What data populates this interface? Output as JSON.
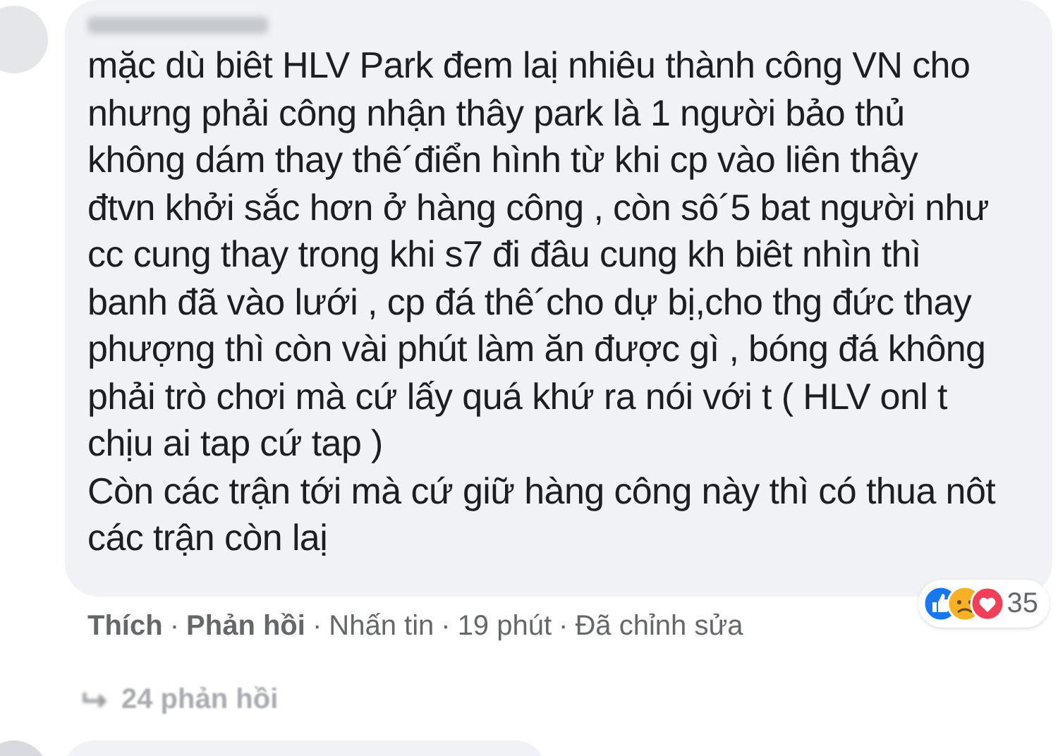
{
  "comment": {
    "lines": [
      "mặc dù biêt HLV Park đem laị nhiêu thành công VN cho",
      "nhưng phải công nhận thây park là 1 người bảo thủ",
      "không dám thay thê´điển hình từ khi cp vào liên thây",
      "đtvn khởi sắc hơn ở hàng công , còn sô´5 bat người như",
      "cc cung thay trong khi s7 đi đâu cung kh biêt nhìn thì",
      "banh đã vào lưới , cp đá thê´cho dự bị,cho thg đức thay",
      "phượng thì còn vài phút làm ăn được gì , bóng đá không",
      "phải trò chơi mà cứ lấy quá khứ ra nói với t ( HLV onl t",
      "chịu ai tap cứ tap )",
      "Còn các trận tới mà cứ giữ hàng công này thì có thua nôt",
      "các trận còn laị"
    ],
    "reaction_count": "35",
    "actions": [
      {
        "label": "Thích",
        "kind": "link"
      },
      {
        "label": "Phản hồi",
        "kind": "link"
      },
      {
        "label": "Nhấn tin",
        "kind": "meta"
      },
      {
        "label": "19 phút",
        "kind": "meta"
      },
      {
        "label": "Đã chỉnh sửa",
        "kind": "meta"
      }
    ],
    "separator": "·",
    "replies": "24 phản hồi"
  }
}
